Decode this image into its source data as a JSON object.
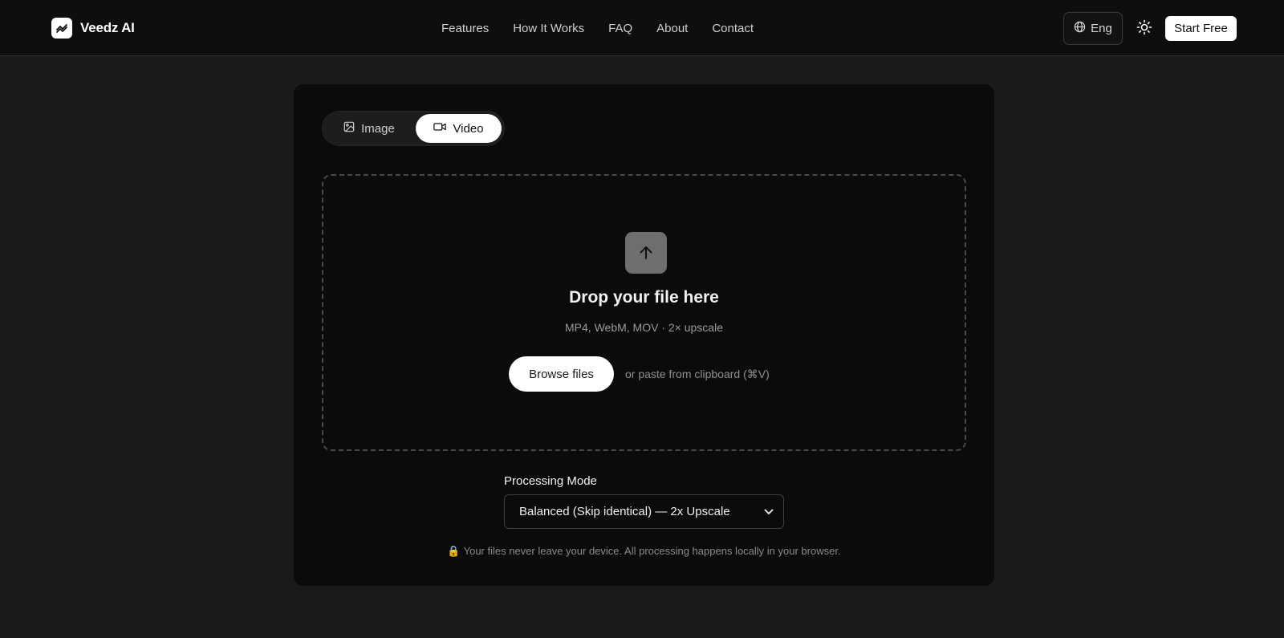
{
  "header": {
    "brand_name": "Veedz AI",
    "nav": [
      "Features",
      "How It Works",
      "FAQ",
      "About",
      "Contact"
    ],
    "lang_label": "Eng",
    "start_label": "Start Free"
  },
  "toggle": {
    "image_label": "Image",
    "video_label": "Video",
    "selected": "Video"
  },
  "dropzone": {
    "title": "Drop your file here",
    "subtitle": "MP4, WebM, MOV · 2× upscale",
    "browse_label": "Browse files",
    "paste_hint": "or paste from clipboard (⌘V)"
  },
  "processing": {
    "label": "Processing Mode",
    "selected_value": "Balanced (Skip identical) — 2x Upscale"
  },
  "privacy": {
    "lock_icon": "🔒",
    "text": "Your files never leave your device. All processing happens locally in your browser."
  },
  "colors": {
    "background": "#1a1a1a",
    "card": "#0b0b0b",
    "accent": "#ffffff"
  }
}
